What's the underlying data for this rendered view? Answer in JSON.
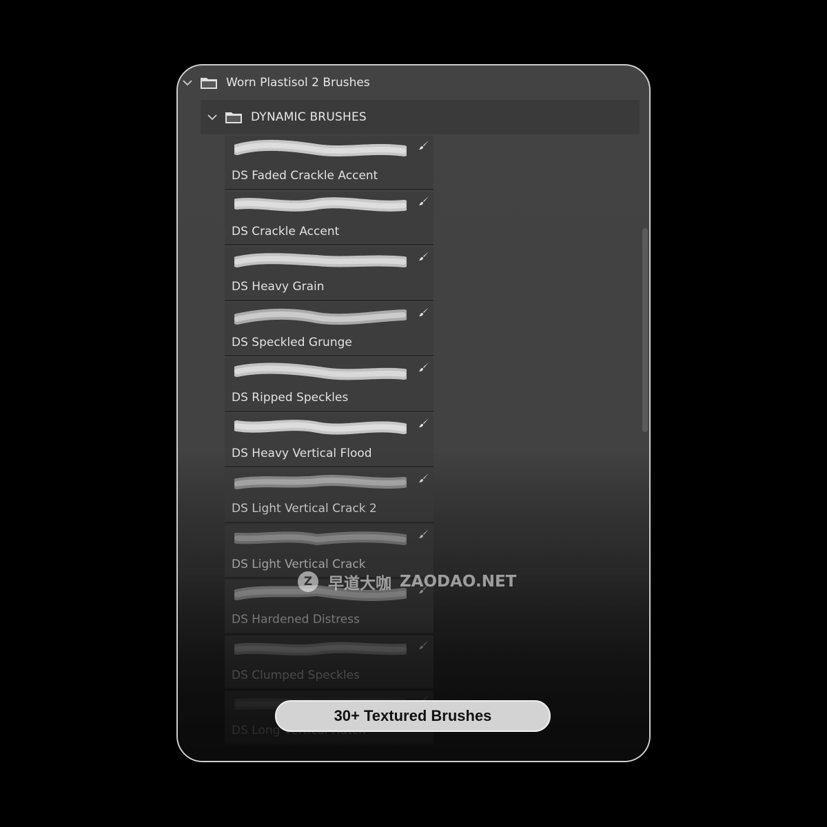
{
  "tree": {
    "root_label": "Worn Plastisol 2 Brushes",
    "group_label": "DYNAMIC BRUSHES"
  },
  "brushes": [
    {
      "name": "DS Faded Crackle Accent",
      "icon": "brush-icon"
    },
    {
      "name": "DS Crackle Accent",
      "icon": "brush-icon"
    },
    {
      "name": "DS Heavy Grain",
      "icon": "brush-icon"
    },
    {
      "name": "DS Speckled Grunge",
      "icon": "brush-icon"
    },
    {
      "name": "DS Ripped Speckles",
      "icon": "brush-icon"
    },
    {
      "name": "DS Heavy Vertical Flood",
      "icon": "brush-icon"
    },
    {
      "name": "DS Light Vertical Crack 2",
      "icon": "brush-icon"
    },
    {
      "name": "DS Light Vertical Crack",
      "icon": "brush-icon"
    },
    {
      "name": "DS Hardened Distress",
      "icon": "brush-icon"
    },
    {
      "name": "DS Clumped Speckles",
      "icon": "brush-icon"
    },
    {
      "name": "DS Long Vertical Hatch",
      "icon": "brush-icon"
    }
  ],
  "badge": {
    "label": "30+ Textured Brushes"
  },
  "watermark": {
    "logo": "Z",
    "cn": "早道大咖",
    "site": "ZAODAO.NET"
  },
  "colors": {
    "background": "#000000",
    "panel": "#434343",
    "pill": "#d3d3d3"
  }
}
